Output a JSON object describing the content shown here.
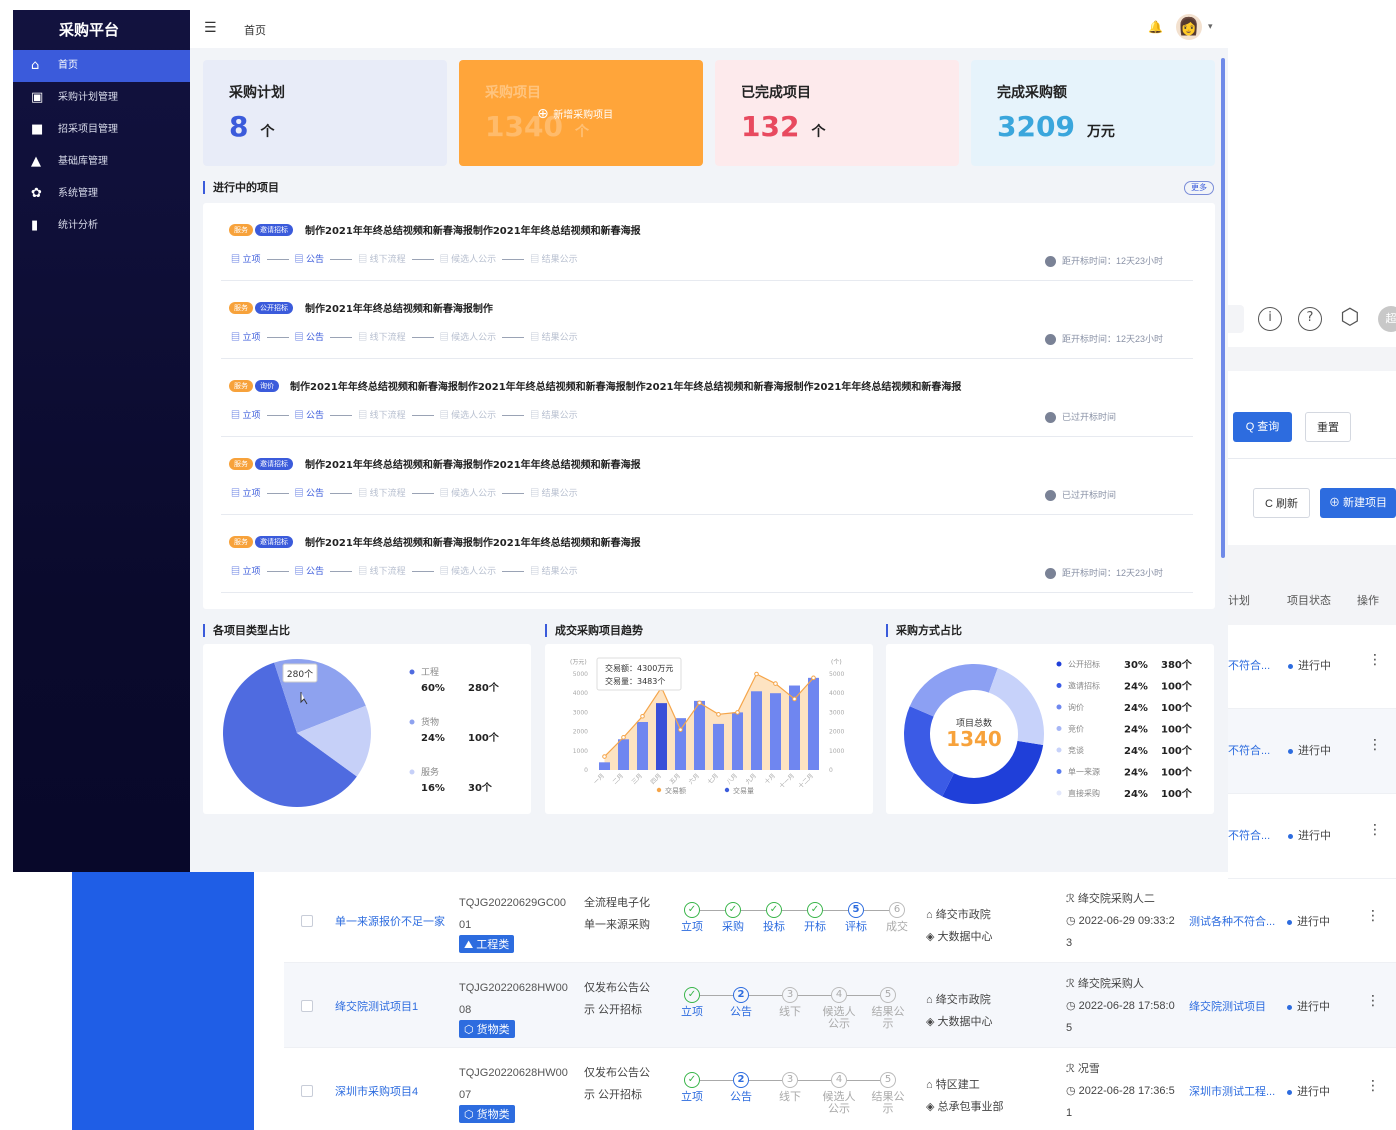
{
  "background": {
    "toolbar_icons": [
      "info-icon",
      "help-icon",
      "hexagon-icon"
    ],
    "avatar_text": "超",
    "query_button": "Q 查询",
    "reset_button": "重置",
    "refresh_button": "C 刷新",
    "new_project_button": "⊕ 新建项目",
    "columns": {
      "plan": "计划",
      "status": "项目状态",
      "ops": "操作"
    },
    "right_rows": [
      {
        "plan": "不符合...",
        "status": "进行中",
        "dots": "⋮"
      },
      {
        "plan": "不符合...",
        "status": "进行中",
        "dots": "⋮"
      },
      {
        "plan": "不符合...",
        "status": "进行中",
        "dots": "⋮"
      }
    ],
    "rows": [
      {
        "name": "单一来源报价不足一家",
        "code": "TQJG20220629GC0001",
        "tag": "⛰ 工程类",
        "mode": "全流程电子化 单一来源采购",
        "steps": [
          {
            "n": "✓",
            "l": "立项",
            "s": "done"
          },
          {
            "n": "✓",
            "l": "采购",
            "s": "done"
          },
          {
            "n": "✓",
            "l": "投标",
            "s": "done"
          },
          {
            "n": "✓",
            "l": "开标",
            "s": "done"
          },
          {
            "n": "5",
            "l": "评标",
            "s": "cur"
          },
          {
            "n": "6",
            "l": "成交",
            "s": ""
          }
        ],
        "org1": "绛交市政院",
        "org2": "大数据中心",
        "buyer": "绛交院采购人二",
        "time": "2022-06-29 09:33:23",
        "plan": "测试各种不符合...",
        "status": "进行中",
        "dots": "⋮"
      },
      {
        "name": "绛交院测试项目1",
        "code": "TQJG20220628HW0008",
        "tag": "⬡ 货物类",
        "mode": "仅发布公告公示 公开招标",
        "steps": [
          {
            "n": "✓",
            "l": "立项",
            "s": "done"
          },
          {
            "n": "2",
            "l": "公告",
            "s": "cur"
          },
          {
            "n": "3",
            "l": "线下",
            "s": ""
          },
          {
            "n": "4",
            "l": "候选人公示",
            "s": ""
          },
          {
            "n": "5",
            "l": "结果公示",
            "s": ""
          }
        ],
        "org1": "绛交市政院",
        "org2": "大数据中心",
        "buyer": "绛交院采购人",
        "time": "2022-06-28 17:58:05",
        "plan": "绛交院测试项目",
        "status": "进行中",
        "dots": "⋮"
      },
      {
        "name": "深圳市采购项目4",
        "code": "TQJG20220628HW0007",
        "tag": "⬡ 货物类",
        "mode": "仅发布公告公示 公开招标",
        "steps": [
          {
            "n": "✓",
            "l": "立项",
            "s": "done"
          },
          {
            "n": "2",
            "l": "公告",
            "s": "cur"
          },
          {
            "n": "3",
            "l": "线下",
            "s": ""
          },
          {
            "n": "4",
            "l": "候选人公示",
            "s": ""
          },
          {
            "n": "5",
            "l": "结果公示",
            "s": ""
          }
        ],
        "org1": "特区建工",
        "org2": "总承包事业部",
        "buyer": "况雪",
        "time": "2022-06-28 17:36:51",
        "plan": "深圳市测试工程...",
        "status": "进行中",
        "dots": "⋮"
      }
    ]
  },
  "sidebar": {
    "brand": "采购平台",
    "items": [
      {
        "label": "首页",
        "icon": "home-icon",
        "glyph": "⌂",
        "active": true
      },
      {
        "label": "采购计划管理",
        "icon": "calendar-icon",
        "glyph": "▣"
      },
      {
        "label": "招采项目管理",
        "icon": "folder-icon",
        "glyph": "■"
      },
      {
        "label": "基础库管理",
        "icon": "warehouse-icon",
        "glyph": "▲"
      },
      {
        "label": "系统管理",
        "icon": "gear-icon",
        "glyph": "✿"
      },
      {
        "label": "统计分析",
        "icon": "bar-chart-icon",
        "glyph": "▮"
      }
    ]
  },
  "topbar": {
    "menu_glyph": "☰",
    "breadcrumb": "首页",
    "bell": "🔔",
    "avatar": "👩",
    "caret": "▾"
  },
  "stats": [
    {
      "title": "采购计划",
      "value": "8",
      "unit": "个",
      "color": "#3b5bdb",
      "bg": "#e8ecf8"
    },
    {
      "title": "采购项目",
      "value": "1340",
      "unit": "个",
      "color": "#f7a23b",
      "bg": "#ffa53a",
      "hover_label": "新增采购项目"
    },
    {
      "title": "已完成项目",
      "value": "132",
      "unit": "个",
      "color": "#e84a5f",
      "bg": "#fdeaec"
    },
    {
      "title": "完成采购额",
      "value": "3209",
      "unit": "万元",
      "color": "#3aa6dc",
      "bg": "#e6f3fb"
    }
  ],
  "ongoing": {
    "title": "进行中的项目",
    "more": "更多",
    "flow": [
      "立项",
      "公告",
      "线下流程",
      "候选人公示",
      "结果公示"
    ],
    "items": [
      {
        "badges": [
          "服务",
          "邀请招标"
        ],
        "title": "制作2021年年终总结视频和新春海报制作2021年年终总结视频和新春海报",
        "time": "距开标时间：12天23小时"
      },
      {
        "badges": [
          "服务",
          "公开招标"
        ],
        "title": "制作2021年年终总结视频和新春海报制作",
        "time": "距开标时间：12天23小时"
      },
      {
        "badges": [
          "服务",
          "询价"
        ],
        "title": "制作2021年年终总结视频和新春海报制作2021年年终总结视频和新春海报制作2021年年终总结视频和新春海报制作2021年年终总结视频和新春海报",
        "time": "已过开标时间"
      },
      {
        "badges": [
          "服务",
          "邀请招标"
        ],
        "title": "制作2021年年终总结视频和新春海报制作2021年年终总结视频和新春海报",
        "time": "已过开标时间"
      },
      {
        "badges": [
          "服务",
          "邀请招标"
        ],
        "title": "制作2021年年终总结视频和新春海报制作2021年年终总结视频和新春海报",
        "time": "距开标时间：12天23小时"
      }
    ]
  },
  "charts_titles": {
    "pie": "各项目类型占比",
    "trend": "成交采购项目趋势",
    "donut": "采购方式占比"
  },
  "chart_data": [
    {
      "type": "pie",
      "title": "各项目类型占比",
      "tooltip": "280个",
      "slices": [
        {
          "name": "工程",
          "pct": "60%",
          "count": "280个",
          "value": 60,
          "color": "#4f6be0"
        },
        {
          "name": "货物",
          "pct": "24%",
          "count": "100个",
          "value": 24,
          "color": "#8ea2ef"
        },
        {
          "name": "服务",
          "pct": "16%",
          "count": "30个",
          "value": 16,
          "color": "#c6d0f8"
        }
      ]
    },
    {
      "type": "bar",
      "title": "成交采购项目趋势",
      "left_axis_label": "(万元)",
      "right_axis_label": "(个)",
      "categories": [
        "一月",
        "二月",
        "三月",
        "四月",
        "五月",
        "六月",
        "七月",
        "八月",
        "九月",
        "十月",
        "十一月",
        "十二月"
      ],
      "y_ticks": [
        "0",
        "1000",
        "2000",
        "3000",
        "4000",
        "5000"
      ],
      "ylim": [
        0,
        5000
      ],
      "series": [
        {
          "name": "交易额",
          "type": "line",
          "values": [
            700,
            1700,
            2800,
            4300,
            2100,
            3500,
            2900,
            3000,
            5000,
            4500,
            3700,
            4800
          ]
        },
        {
          "name": "交易量",
          "type": "bar",
          "values": [
            400,
            1600,
            2500,
            3483,
            2700,
            3600,
            2400,
            3000,
            4100,
            4000,
            4400,
            4800
          ]
        }
      ],
      "tooltip": {
        "line1": "交易额：4300万元",
        "line2": "交易量：3483个"
      }
    },
    {
      "type": "pie",
      "title": "采购方式占比",
      "center_label": "项目总数",
      "center_value": "1340",
      "slices": [
        {
          "name": "公开招标",
          "pct": "30%",
          "count": "380个",
          "value": 30,
          "color": "#1f3fd9"
        },
        {
          "name": "邀请招标",
          "pct": "24%",
          "count": "100个",
          "value": 24,
          "color": "#3b5be6"
        },
        {
          "name": "询价",
          "pct": "24%",
          "count": "100个",
          "value": 24,
          "color": "#6f88ef"
        },
        {
          "name": "竞价",
          "pct": "24%",
          "count": "100个",
          "value": 24,
          "color": "#a6b6f6"
        },
        {
          "name": "竞谈",
          "pct": "24%",
          "count": "100个",
          "value": 24,
          "color": "#c7d2fa"
        },
        {
          "name": "单一来源",
          "pct": "24%",
          "count": "100个",
          "value": 24,
          "color": "#5a7cf0"
        },
        {
          "name": "直接采购",
          "pct": "24%",
          "count": "100个",
          "value": 24,
          "color": "#e3e8fc"
        }
      ]
    }
  ]
}
